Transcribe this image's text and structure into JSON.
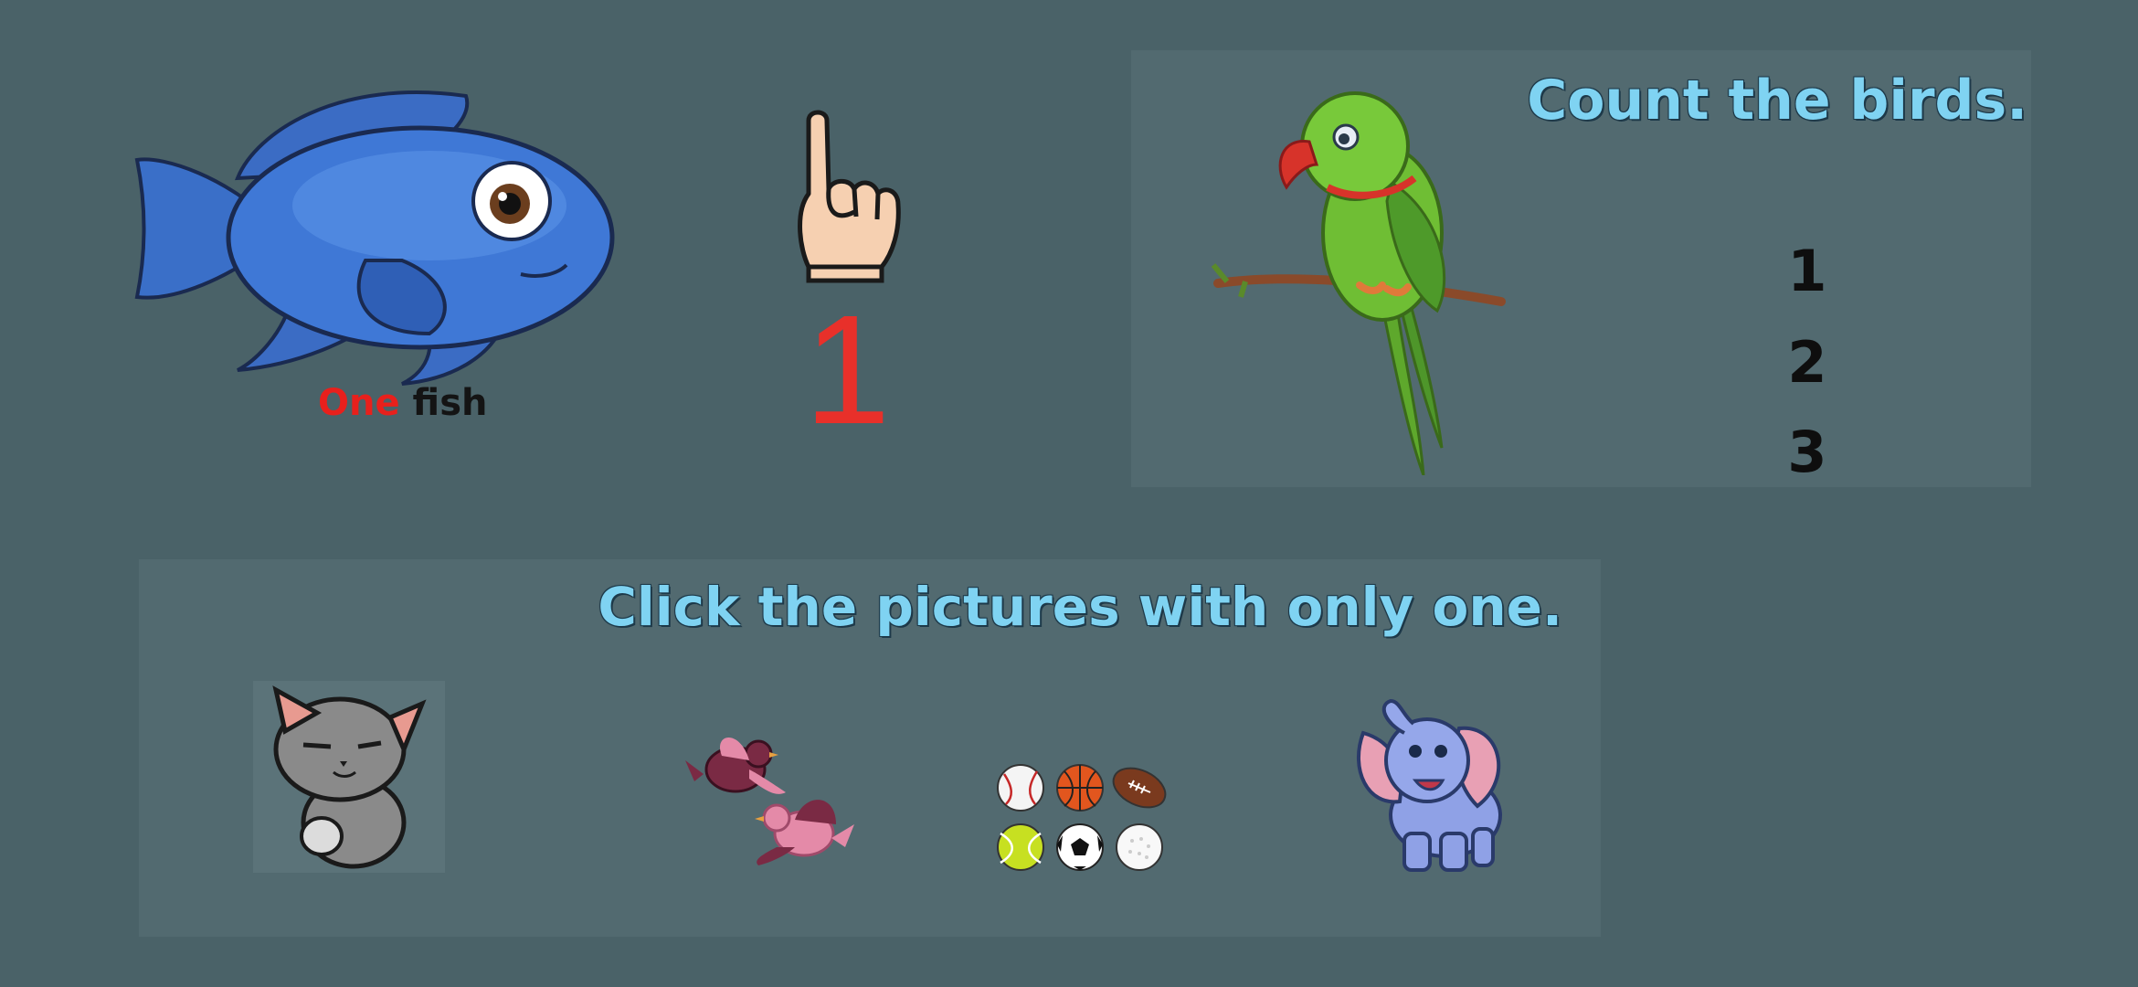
{
  "lesson": {
    "caption_word1": "One",
    "caption_word2": "fish",
    "numeral": "1"
  },
  "count_panel": {
    "heading": "Count the birds.",
    "options": [
      "1",
      "2",
      "3"
    ]
  },
  "select_panel": {
    "heading": "Click the pictures with only one."
  },
  "colors": {
    "background": "#4a6268",
    "panel": "#526a70",
    "heading": "#7fd3f2",
    "numeral": "#e8302a",
    "caption_highlight": "#e8201c"
  }
}
